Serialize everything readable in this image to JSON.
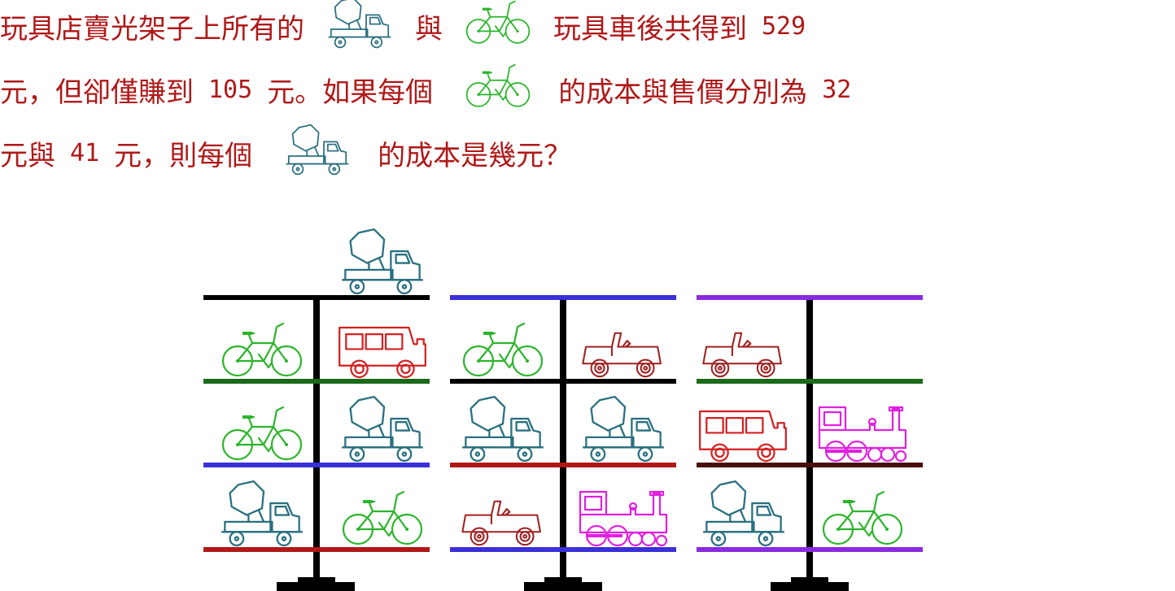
{
  "question": {
    "line1": {
      "pre": "玩具店賣光架子上所有的",
      "icon1": "cement-mixer-truck-icon",
      "mid": "與",
      "icon2": "bicycle-icon",
      "post": "玩具車後共得到",
      "num": "529"
    },
    "line2": {
      "pre": "元，但卻僅賺到",
      "num1": "105",
      "mid": "元。如果每個",
      "icon": "bicycle-icon",
      "post": "的成本與售價分別為",
      "num2": "32"
    },
    "line3": {
      "pre": "元與",
      "num": "41",
      "mid": "元，則每個",
      "icon": "cement-mixer-truck-icon",
      "post": "的成本是幾元？"
    }
  },
  "colors": {
    "text": "#b01818",
    "mixer": "#2a7080",
    "bicycle": "#2bb52b",
    "bus": "#d42020",
    "jeep": "#a02020",
    "train": "#e020e0",
    "pole": "#000000"
  },
  "shelves": [
    {
      "name": "shelf-unit-1",
      "top_item": "cement-mixer-truck",
      "rows": [
        {
          "left": "bicycle",
          "right": "bus"
        },
        {
          "left": "bicycle",
          "right": "cement-mixer-truck"
        },
        {
          "left": "cement-mixer-truck",
          "right": "bicycle"
        }
      ]
    },
    {
      "name": "shelf-unit-2",
      "top_item": "",
      "rows": [
        {
          "left": "bicycle",
          "right": "jeep"
        },
        {
          "left": "cement-mixer-truck",
          "right": "cement-mixer-truck"
        },
        {
          "left": "jeep",
          "right": "steam-train"
        }
      ]
    },
    {
      "name": "shelf-unit-3",
      "top_item": "",
      "rows": [
        {
          "left": "jeep",
          "right": ""
        },
        {
          "left": "bus",
          "right": "steam-train"
        },
        {
          "left": "cement-mixer-truck",
          "right": "bicycle"
        }
      ]
    }
  ]
}
